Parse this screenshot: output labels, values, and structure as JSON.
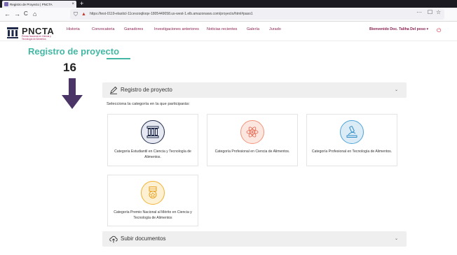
{
  "browser": {
    "tab_title": "Registro de Proyecto | PNCTA",
    "tab_close": "×",
    "new_tab": "+",
    "back": "←",
    "forward": "→",
    "reload": "C",
    "home": "⌂",
    "url": "https://test-0119-elasticl-11cevzoqlioqv-1805449058.us-west-1.elb.amazonaws.com/proyecto/html#paso1",
    "pocket": "☐",
    "more": "···",
    "star": "☆"
  },
  "site": {
    "logo_title": "PNCTA",
    "logo_subtitle": "Premio Nacional en Ciencia y Tecnología de Alimentos",
    "menu": [
      "Historia",
      "Convocatoria",
      "Ganadores",
      "Investigaciones anteriores",
      "Noticias recientes",
      "Galería",
      "Jurado"
    ],
    "welcome": "Bienvenido Doc. Taliha Del poso ▾",
    "logout": "⏻"
  },
  "page": {
    "title": "Registro de proyecto",
    "step_number": "16",
    "accordion_registro": "Registro de proyecto",
    "instructions": "Selecciona la categoría en la que participarás:",
    "accordion_subir": "Subir documentos",
    "chevron": "⌄"
  },
  "categories": [
    {
      "label": "Categoría Estudiantil en Ciencia y Tecnología de Alimentos.",
      "icon": "columns-icon",
      "color": "#1f2a4a"
    },
    {
      "label": "Categoría Profesional en Ciencia de Alimentos.",
      "icon": "atom-icon",
      "color": "#f29479"
    },
    {
      "label": "Categoría Profesional en Tecnología de Alimentos.",
      "icon": "microscope-icon",
      "color": "#4ba3d9"
    },
    {
      "label": "Categoría Premio Nacional al Mérito en Ciencia y Tecnología de Alimentos",
      "icon": "medal-icon",
      "color": "#f2b233"
    }
  ],
  "colors": {
    "accent": "#43b7a4",
    "menu": "#8a2050",
    "arrow": "#4a3566"
  }
}
